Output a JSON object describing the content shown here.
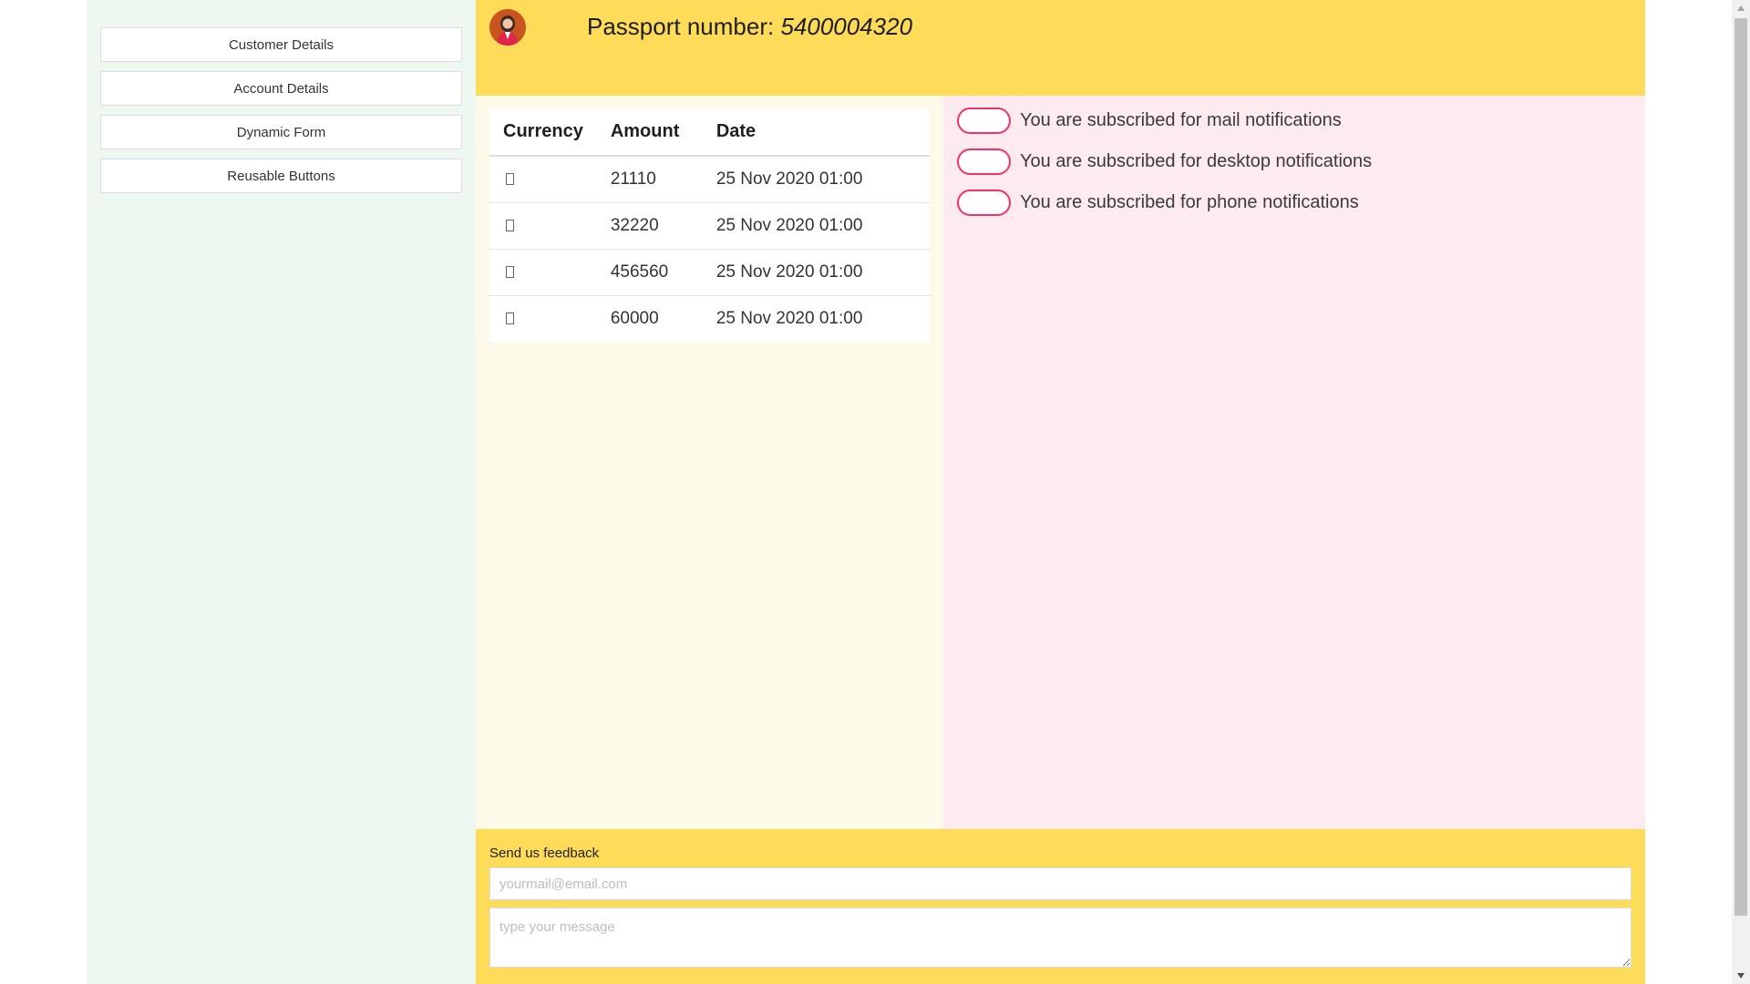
{
  "sidebar": {
    "items": [
      {
        "label": "Customer Details"
      },
      {
        "label": "Account Details"
      },
      {
        "label": "Dynamic Form"
      },
      {
        "label": "Reusable Buttons"
      }
    ]
  },
  "header": {
    "passport_label": "Passport number:",
    "passport_number": "5400004320",
    "avatar_icon": "user-avatar-icon"
  },
  "transactions": {
    "columns": [
      "Currency",
      "Amount",
      "Date"
    ],
    "rows": [
      {
        "currency_icon": "missing-glyph-icon",
        "amount": "21110",
        "date": "25 Nov 2020 01:00"
      },
      {
        "currency_icon": "missing-glyph-icon",
        "amount": "32220",
        "date": "25 Nov 2020 01:00"
      },
      {
        "currency_icon": "missing-glyph-icon",
        "amount": "456560",
        "date": "25 Nov 2020 01:00"
      },
      {
        "currency_icon": "missing-glyph-icon",
        "amount": "60000",
        "date": "25 Nov 2020 01:00"
      }
    ]
  },
  "notifications": [
    {
      "text": "You are subscribed for mail notifications",
      "enabled": false
    },
    {
      "text": "You are subscribed for desktop notifications",
      "enabled": false
    },
    {
      "text": "You are subscribed for phone notifications",
      "enabled": false
    }
  ],
  "feedback": {
    "label": "Send us feedback",
    "email_value": "",
    "email_placeholder": "yourmail@email.com",
    "message_value": "",
    "message_placeholder": "type your message"
  },
  "colors": {
    "header_bg": "#ffdb5a",
    "sidebar_bg": "#eef8f1",
    "table_panel_bg": "#fefae9",
    "notif_panel_bg": "#feebef",
    "toggle_border": "#f0326a"
  }
}
